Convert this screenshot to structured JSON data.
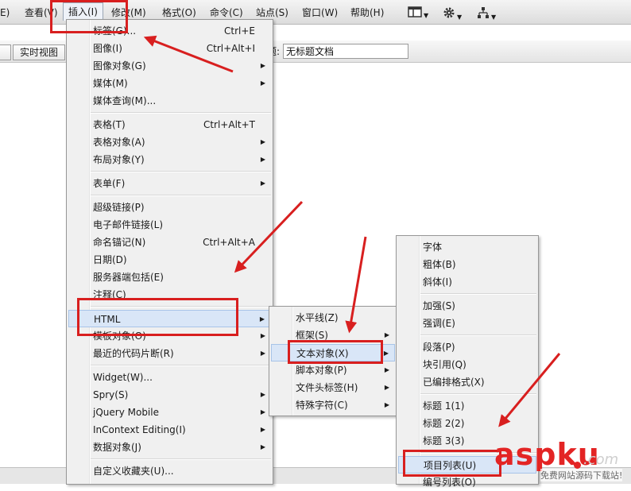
{
  "menubar": {
    "items": [
      "E)",
      "查看(V)",
      "插入(I)",
      "修改(M)",
      "格式(O)",
      "命令(C)",
      "站点(S)",
      "窗口(W)",
      "帮助(H)"
    ],
    "tool_icons": [
      "layout-icon",
      "gear-icon",
      "site-icon"
    ]
  },
  "toolbar": {
    "live_view": "实时视图",
    "title_label": "题:",
    "title_value": "无标题文档"
  },
  "insert_menu": [
    {
      "label": "标签(G)...",
      "shortcut": "Ctrl+E"
    },
    {
      "label": "图像(I)",
      "shortcut": "Ctrl+Alt+I"
    },
    {
      "label": "图像对象(G)",
      "submenu": true
    },
    {
      "label": "媒体(M)",
      "submenu": true
    },
    {
      "label": "媒体查询(M)..."
    },
    {
      "sep": true
    },
    {
      "label": "表格(T)",
      "shortcut": "Ctrl+Alt+T"
    },
    {
      "label": "表格对象(A)",
      "submenu": true
    },
    {
      "label": "布局对象(Y)",
      "submenu": true
    },
    {
      "sep": true
    },
    {
      "label": "表单(F)",
      "submenu": true
    },
    {
      "sep": true
    },
    {
      "label": "超级链接(P)"
    },
    {
      "label": "电子邮件链接(L)"
    },
    {
      "label": "命名锚记(N)",
      "shortcut": "Ctrl+Alt+A"
    },
    {
      "label": "日期(D)"
    },
    {
      "label": "服务器端包括(E)"
    },
    {
      "label": "注释(C)"
    },
    {
      "sep": true
    },
    {
      "label": "HTML",
      "submenu": true,
      "highlight": true
    },
    {
      "label": "模板对象(O)",
      "submenu": true
    },
    {
      "label": "最近的代码片断(R)",
      "submenu": true
    },
    {
      "sep": true
    },
    {
      "label": "Widget(W)..."
    },
    {
      "label": "Spry(S)",
      "submenu": true
    },
    {
      "label": "jQuery Mobile",
      "submenu": true
    },
    {
      "label": "InContext Editing(I)",
      "submenu": true
    },
    {
      "label": "数据对象(J)",
      "submenu": true
    },
    {
      "sep": true
    },
    {
      "label": "自定义收藏夹(U)..."
    }
  ],
  "html_menu": [
    {
      "label": "水平线(Z)"
    },
    {
      "label": "框架(S)",
      "submenu": true
    },
    {
      "label": "文本对象(X)",
      "submenu": true,
      "highlight": true
    },
    {
      "label": "脚本对象(P)",
      "submenu": true
    },
    {
      "label": "文件头标签(H)",
      "submenu": true
    },
    {
      "label": "特殊字符(C)",
      "submenu": true
    }
  ],
  "text_menu": [
    {
      "label": "字体"
    },
    {
      "label": "粗体(B)"
    },
    {
      "label": "斜体(I)"
    },
    {
      "sep": true
    },
    {
      "label": "加强(S)"
    },
    {
      "label": "强调(E)"
    },
    {
      "sep": true
    },
    {
      "label": "段落(P)"
    },
    {
      "label": "块引用(Q)"
    },
    {
      "label": "已编排格式(X)"
    },
    {
      "sep": true
    },
    {
      "label": "标题 1(1)"
    },
    {
      "label": "标题 2(2)"
    },
    {
      "label": "标题 3(3)"
    },
    {
      "sep": true
    },
    {
      "label": "项目列表(U)",
      "highlight": true
    },
    {
      "label": "编号列表(O)"
    }
  ],
  "watermark": {
    "logo_a": "asp",
    "logo_b": "ku",
    "suffix": ".com",
    "subtitle": "免费网站源码下载站!"
  },
  "colors": {
    "annotation_red": "#d81f1f",
    "menu_bg": "#f0f0f0",
    "highlight_bg": "#d9e6f7"
  }
}
